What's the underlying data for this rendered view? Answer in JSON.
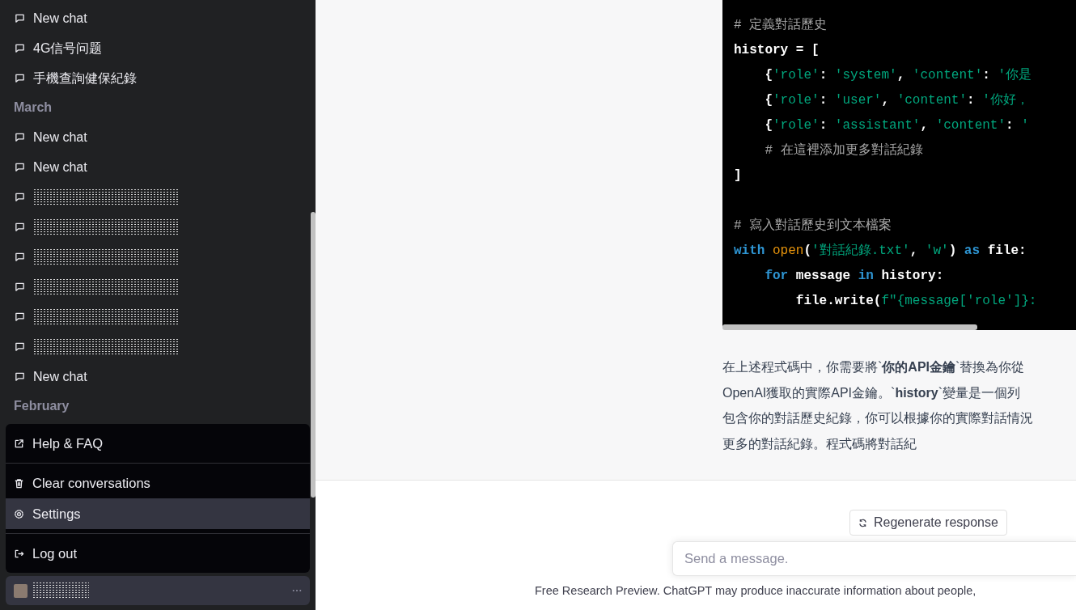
{
  "sidebar": {
    "groups": [
      {
        "items": [
          {
            "kind": "chat",
            "title": "New chat"
          },
          {
            "kind": "chat",
            "title": "4G信号问题"
          },
          {
            "kind": "chat",
            "title": "手機查詢健保紀錄"
          }
        ]
      },
      {
        "heading": "March",
        "items": [
          {
            "kind": "chat",
            "title": "New chat"
          },
          {
            "kind": "chat",
            "title": "New chat"
          },
          {
            "kind": "redacted"
          },
          {
            "kind": "redacted"
          },
          {
            "kind": "redacted"
          },
          {
            "kind": "redacted"
          },
          {
            "kind": "redacted"
          },
          {
            "kind": "redacted"
          },
          {
            "kind": "chat",
            "title": "New chat"
          }
        ]
      },
      {
        "heading": "February"
      }
    ],
    "menu": {
      "sections": [
        [
          {
            "kind": "external",
            "label": "Help & FAQ",
            "selected": false
          }
        ],
        [
          {
            "kind": "trash",
            "label": "Clear conversations",
            "selected": false
          },
          {
            "kind": "gear",
            "label": "Settings",
            "selected": true
          }
        ],
        [
          {
            "kind": "logout",
            "label": "Log out",
            "selected": false
          }
        ]
      ]
    },
    "user": {
      "kind": "redacted"
    }
  },
  "code": {
    "lines": [
      {
        "tokens": [
          {
            "kind": "comment",
            "text": "# 定義對話歷史"
          }
        ]
      },
      {
        "tokens": [
          {
            "kind": "plain",
            "text": "history = ["
          }
        ]
      },
      {
        "tokens": [
          {
            "kind": "plain",
            "text": "    {"
          },
          {
            "kind": "string",
            "text": "'role'"
          },
          {
            "kind": "plain",
            "text": ": "
          },
          {
            "kind": "string",
            "text": "'system'"
          },
          {
            "kind": "plain",
            "text": ", "
          },
          {
            "kind": "string",
            "text": "'content'"
          },
          {
            "kind": "plain",
            "text": ": "
          },
          {
            "kind": "string",
            "text": "'你是"
          }
        ]
      },
      {
        "tokens": [
          {
            "kind": "plain",
            "text": "    {"
          },
          {
            "kind": "string",
            "text": "'role'"
          },
          {
            "kind": "plain",
            "text": ": "
          },
          {
            "kind": "string",
            "text": "'user'"
          },
          {
            "kind": "plain",
            "text": ", "
          },
          {
            "kind": "string",
            "text": "'content'"
          },
          {
            "kind": "plain",
            "text": ": "
          },
          {
            "kind": "string",
            "text": "'你好，"
          }
        ]
      },
      {
        "tokens": [
          {
            "kind": "plain",
            "text": "    {"
          },
          {
            "kind": "string",
            "text": "'role'"
          },
          {
            "kind": "plain",
            "text": ": "
          },
          {
            "kind": "string",
            "text": "'assistant'"
          },
          {
            "kind": "plain",
            "text": ", "
          },
          {
            "kind": "string",
            "text": "'content'"
          },
          {
            "kind": "plain",
            "text": ": "
          },
          {
            "kind": "string",
            "text": "'"
          }
        ]
      },
      {
        "tokens": [
          {
            "kind": "comment",
            "text": "    # 在這裡添加更多對話紀錄"
          }
        ]
      },
      {
        "tokens": [
          {
            "kind": "plain",
            "text": "]"
          }
        ]
      },
      {
        "kind": "blank"
      },
      {
        "tokens": [
          {
            "kind": "comment",
            "text": "# 寫入對話歷史到文本檔案"
          }
        ]
      },
      {
        "tokens": [
          {
            "kind": "keyword",
            "text": "with "
          },
          {
            "kind": "builtin",
            "text": "open"
          },
          {
            "kind": "plain",
            "text": "("
          },
          {
            "kind": "string",
            "text": "'對話紀錄.txt'"
          },
          {
            "kind": "plain",
            "text": ", "
          },
          {
            "kind": "string",
            "text": "'w'"
          },
          {
            "kind": "plain",
            "text": ") "
          },
          {
            "kind": "keyword",
            "text": "as"
          },
          {
            "kind": "plain",
            "text": " file:"
          }
        ]
      },
      {
        "tokens": [
          {
            "kind": "keyword",
            "text": "    for"
          },
          {
            "kind": "plain",
            "text": " message "
          },
          {
            "kind": "keyword",
            "text": "in"
          },
          {
            "kind": "plain",
            "text": " history:"
          }
        ]
      },
      {
        "tokens": [
          {
            "kind": "plain",
            "text": "        file.write("
          },
          {
            "kind": "string",
            "text": "f\"{message['role']}:"
          }
        ]
      }
    ]
  },
  "answer": {
    "lines": [
      "在上述程式碼中，你需要將`**你的API金鑰**`替換為你從",
      "OpenAI獲取的實際API金鑰。`**history**`變量是一個列",
      "包含你的對話歷史紀錄，你可以根據你的實際對話情況",
      "更多的對話紀錄。程式碼將對話紀"
    ]
  },
  "regenerate_button": "Regenerate response",
  "composer": {
    "placeholder": "Send a message."
  },
  "footer": "Free Research Preview. ChatGPT may produce inaccurate information about people,"
}
